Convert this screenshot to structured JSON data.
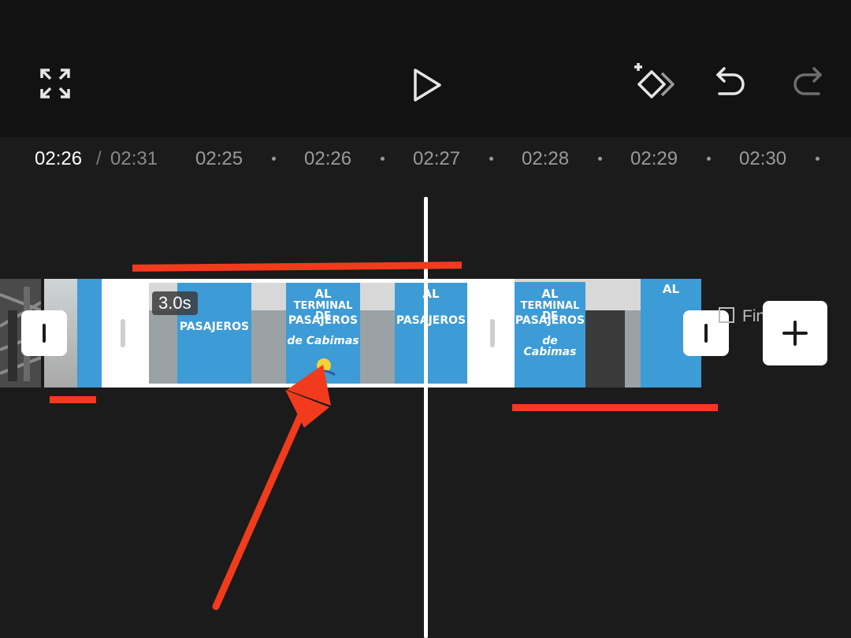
{
  "toolbar": {
    "fullscreen_icon": "fullscreen-icon",
    "play_icon": "play-icon",
    "keyframe_icon": "keyframe-add-icon",
    "undo_icon": "undo-icon",
    "redo_icon": "redo-icon"
  },
  "timeline": {
    "current_time": "02:26",
    "separator": "/",
    "total_time": "02:31",
    "ticks": [
      "02:25",
      "02:26",
      "02:27",
      "02:28",
      "02:29",
      "02:30"
    ]
  },
  "clip": {
    "duration": "3.0s",
    "poster_lines": [
      "AL",
      "TERMINAL DE",
      "PASAJEROS",
      "de Cabimas"
    ]
  },
  "end_label": "Fin",
  "colors": {
    "background": "#1b1b1b",
    "toolbar": "#121212",
    "annotation_red": "#f23b1c",
    "poster_blue": "#3d9bd6"
  }
}
